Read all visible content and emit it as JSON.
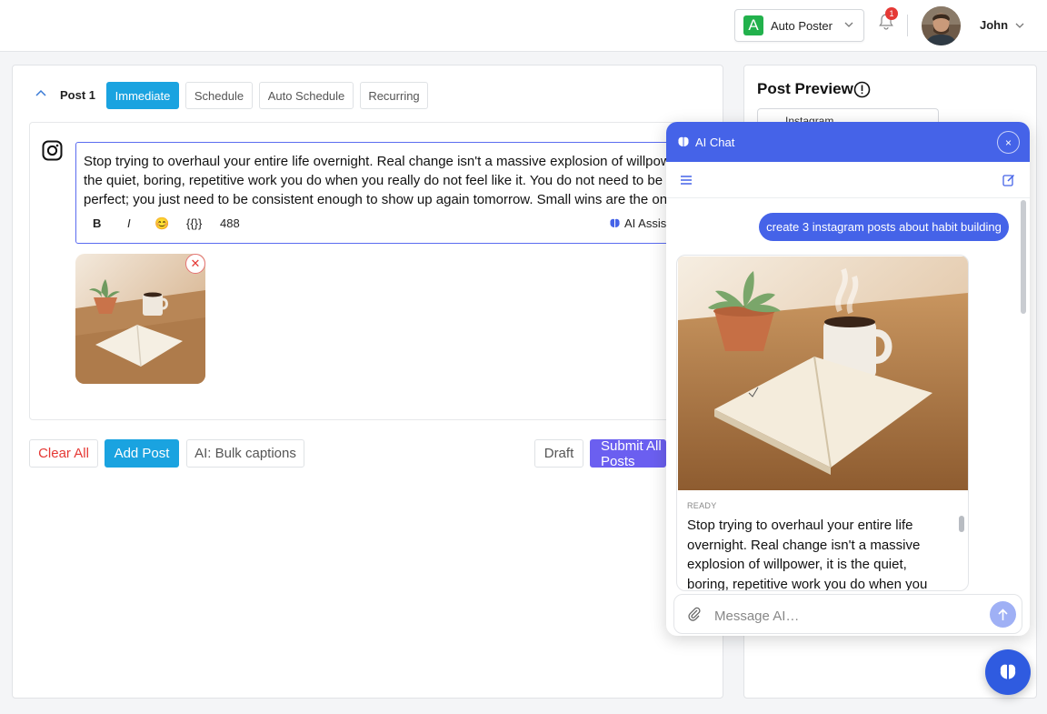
{
  "header": {
    "workspace_letter": "A",
    "workspace_name": "Auto Poster",
    "notification_count": "1",
    "user_name": "John"
  },
  "post": {
    "title": "Post 1",
    "tabs": [
      "Immediate",
      "Schedule",
      "Auto Schedule",
      "Recurring"
    ],
    "active_tab": "Immediate",
    "caption": "Stop trying to overhaul your entire life overnight. Real change isn't a massive explosion of willpower, it is the quiet, boring, repetitive work you do when you really do not feel like it. You do not need to be perfect; you just need to be consistent enough to show up again tomorrow. Small wins are the only way",
    "toolbar": {
      "bold": "B",
      "italic": "I",
      "emoji": "😊",
      "variables": "{{}}",
      "char_count": "488",
      "ai_assist": "AI Assist"
    },
    "remove_image": "✕"
  },
  "actions": {
    "clear_all": "Clear All",
    "add_post": "Add Post",
    "bulk_captions": "AI: Bulk captions",
    "draft": "Draft",
    "submit_all": "Submit All Posts"
  },
  "preview": {
    "title": "Post Preview",
    "platform": "Instagram"
  },
  "chat": {
    "title": "AI Chat",
    "close": "×",
    "user_message": "create 3 instagram posts about habit building",
    "status": "READY",
    "response_text": "Stop trying to overhaul your entire life overnight. Real change isn't a massive explosion of willpower, it is the quiet, boring, repetitive work you do when you really do not feel like it.",
    "input_placeholder": "Message AI…"
  },
  "colors": {
    "primary": "#1aa3e0",
    "chat_blue": "#4563e8",
    "submit_purple": "#6b5ff0",
    "danger": "#e53935",
    "workspace_green": "#22b14c"
  }
}
